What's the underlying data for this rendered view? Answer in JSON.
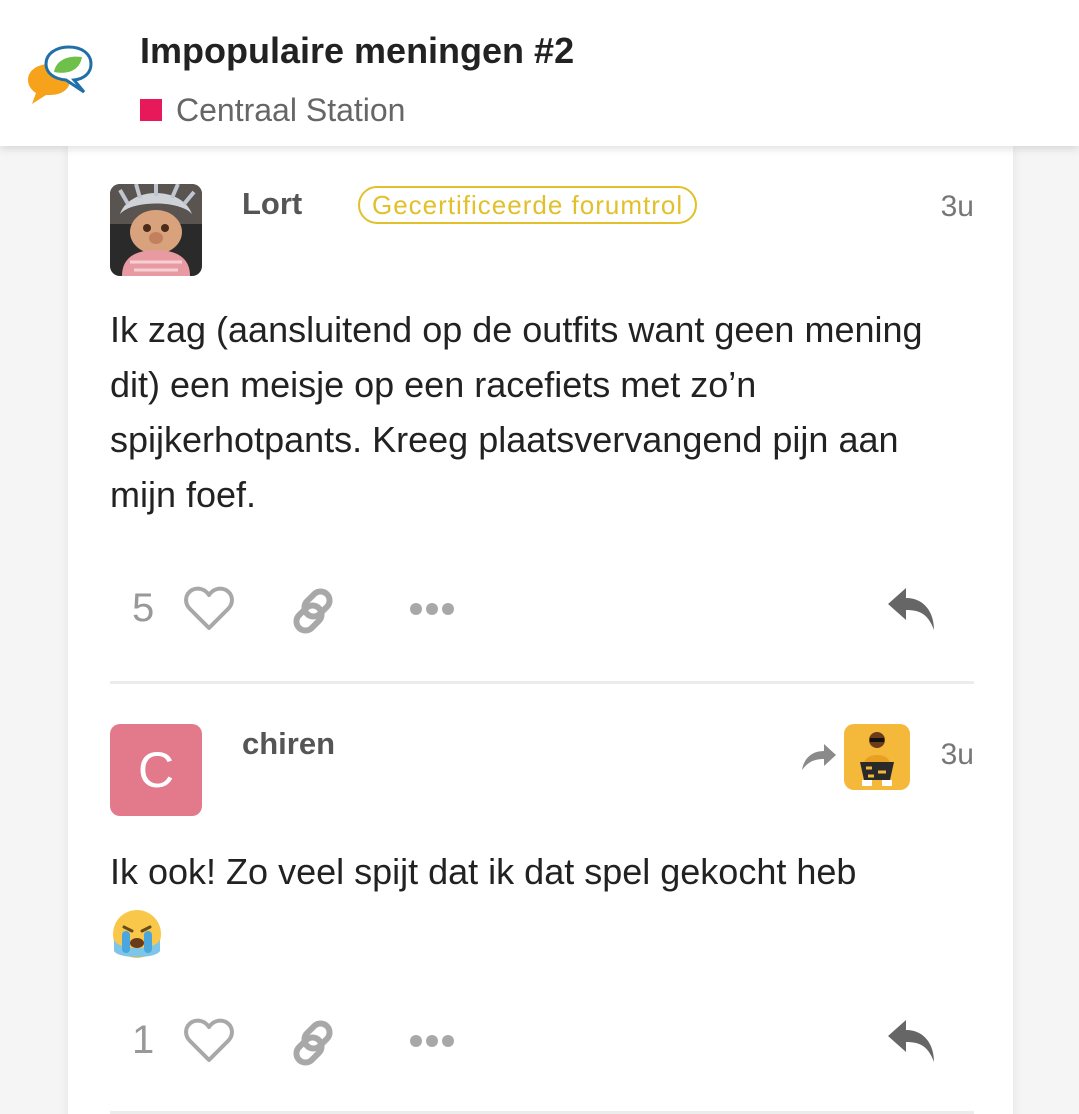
{
  "header": {
    "title": "Impopulaire meningen #2",
    "category": "Centraal Station",
    "category_color": "#e8195a"
  },
  "posts": [
    {
      "username": "Lort",
      "flair": "Gecertificeerde forumtrol",
      "flair_color": "#e2c02c",
      "date": "3u",
      "avatar_icon": "troll-doll-avatar",
      "text": "Ik zag (aansluitend op de outfits want geen mening dit) een meisje op een racefiets met zo’n spijkerhotpants. Kreeg plaatsvervangend pijn aan mijn foef.",
      "likes": "5"
    },
    {
      "username": "chiren",
      "avatar_letter": "C",
      "avatar_color": "#e27a8c",
      "date": "3u",
      "reply_to_avatar_icon": "yellow-user-avatar",
      "text": "Ik ook! Zo veel spijt dat ik dat spel gekocht heb",
      "emoji": "crying-face-icon",
      "likes": "1"
    }
  ],
  "colors": {
    "icon_gray": "#a8a8a8",
    "reply_icon": "#666666"
  }
}
